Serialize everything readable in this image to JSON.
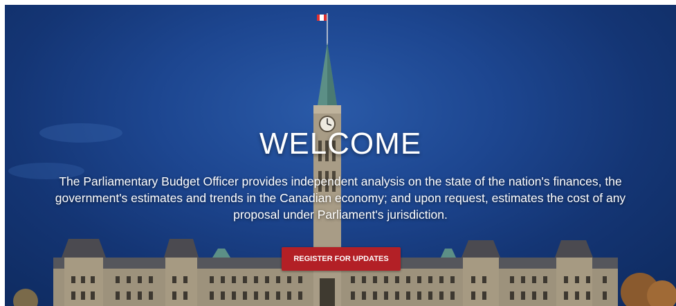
{
  "hero": {
    "title": "WELCOME",
    "description": "The Parliamentary Budget Officer provides independent analysis on the state of the nation's finances, the government's estimates and trends in the Canadian economy; and upon request, estimates the cost of any proposal under Parliament's jurisdiction.",
    "cta_label": "REGISTER FOR UPDATES"
  },
  "colors": {
    "sky": "#1d4690",
    "button": "#b32026"
  }
}
